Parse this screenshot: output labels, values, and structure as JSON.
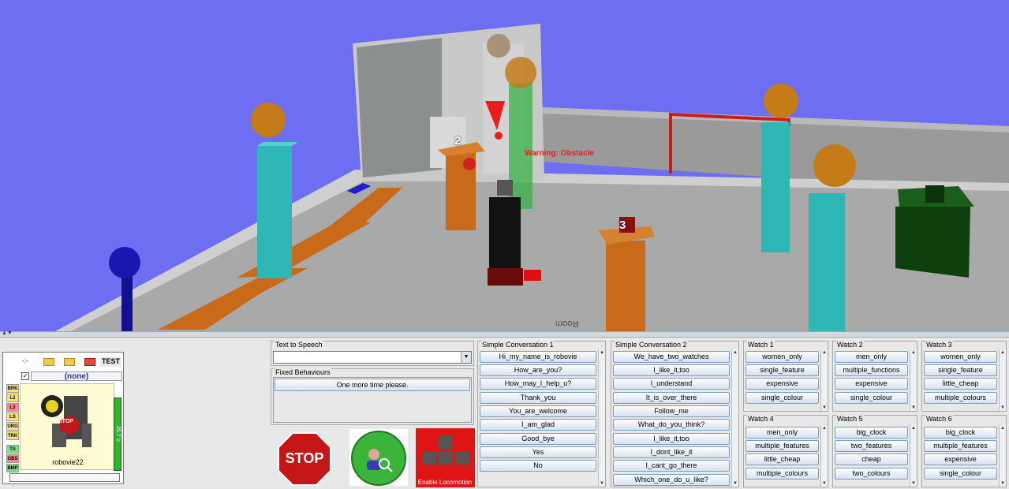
{
  "viewport": {
    "warning_text": "Warning: Obstacle",
    "marker_numbers": [
      "2",
      "3"
    ],
    "floor_text": "Room"
  },
  "robot_panel": {
    "toolbar": {
      "arrows": "-:-",
      "test_label": "TEST"
    },
    "selection": "(none)",
    "checkbox_checked": "✓",
    "status_flags": [
      "BRK",
      "L2",
      "L3",
      "LS",
      "URG",
      "TRK",
      "TS",
      "OBS",
      "BMP"
    ],
    "robot_name": "robovie22",
    "battery_text": "25.7 V",
    "stop_sign_text": "STOP"
  },
  "text_to_speech": {
    "title": "Text to Speech",
    "value": ""
  },
  "fixed_behaviours": {
    "title": "Fixed Behaviours",
    "items": [
      "One more time please."
    ]
  },
  "big_buttons": {
    "stop_label": "STOP",
    "locomotion_label": "Enable Locomotion"
  },
  "simple_conversation_1": {
    "title": "Simple Conversation 1",
    "items": [
      "Hi_my_name_is_robovie",
      "How_are_you?",
      "How_may_I_help_u?",
      "Thank_you",
      "You_are_welcome",
      "I_am_glad",
      "Good_bye",
      "Yes",
      "No"
    ]
  },
  "simple_conversation_2": {
    "title": "Simple Conversation 2",
    "items": [
      "We_have_two_watches",
      "I_like_it,too",
      "I_understand",
      "It_is_over_there",
      "Follow_me",
      "What_do_you_think?",
      "I_like_it,too",
      "I_dont_like_it",
      "I_cant_go_there",
      "Which_one_do_u_like?"
    ]
  },
  "watch_1": {
    "title": "Watch 1",
    "items": [
      "women_only",
      "single_feature",
      "expensive",
      "single_colour"
    ]
  },
  "watch_2": {
    "title": "Watch 2",
    "items": [
      "men_only",
      "multiple_functions",
      "expensive",
      "single_colour"
    ]
  },
  "watch_3": {
    "title": "Watch 3",
    "items": [
      "women_only",
      "single_feature",
      "little_cheap",
      "multiple_colours"
    ]
  },
  "watch_4": {
    "title": "Watch 4",
    "items": [
      "men_only",
      "multiple_features",
      "little_cheap",
      "multiple_colours"
    ]
  },
  "watch_5": {
    "title": "Watch 5",
    "items": [
      "big_clock",
      "two_features",
      "cheap",
      "two_colours"
    ]
  },
  "watch_6": {
    "title": "Watch 6",
    "items": [
      "big_clock",
      "multiple_features",
      "expensive",
      "single_colour"
    ]
  },
  "colors": {
    "sky": "#6e6ef2",
    "floor": "#a9a9a9",
    "orange": "#c86a1a",
    "teal": "#2fb7b7",
    "green_box": "#124d12",
    "warning": "#e81d1d"
  }
}
